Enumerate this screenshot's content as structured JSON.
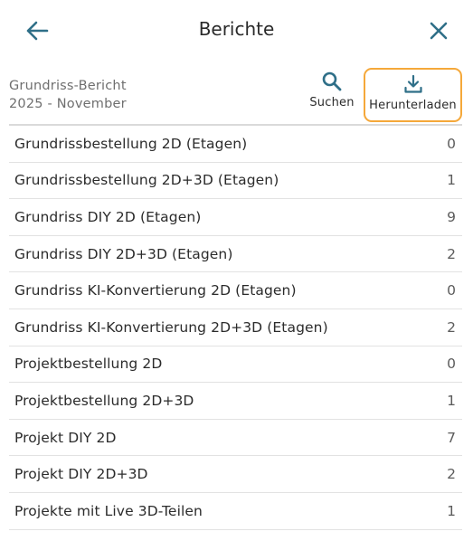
{
  "header": {
    "title": "Berichte",
    "back_icon": "arrow-left-icon",
    "close_icon": "close-icon",
    "accent_color": "#2f6f88"
  },
  "report": {
    "name": "Grundriss-Bericht",
    "period": "2025 - November"
  },
  "actions": {
    "search_label": "Suchen",
    "search_icon": "search-icon",
    "download_label": "Herunterladen",
    "download_icon": "download-icon",
    "highlight_color": "#f5a83a"
  },
  "rows": [
    {
      "name": "Grundrissbestellung 2D (Etagen)",
      "count": "0"
    },
    {
      "name": "Grundrissbestellung 2D+3D (Etagen)",
      "count": "1"
    },
    {
      "name": "Grundriss DIY 2D (Etagen)",
      "count": "9"
    },
    {
      "name": "Grundriss DIY 2D+3D (Etagen)",
      "count": "2"
    },
    {
      "name": "Grundriss KI-Konvertierung 2D (Etagen)",
      "count": "0"
    },
    {
      "name": "Grundriss KI-Konvertierung 2D+3D (Etagen)",
      "count": "2"
    },
    {
      "name": "Projektbestellung 2D",
      "count": "0"
    },
    {
      "name": "Projektbestellung 2D+3D",
      "count": "1"
    },
    {
      "name": "Projekt DIY 2D",
      "count": "7"
    },
    {
      "name": "Projekt DIY 2D+3D",
      "count": "2"
    },
    {
      "name": "Projekte mit Live 3D-Teilen",
      "count": "1"
    }
  ]
}
